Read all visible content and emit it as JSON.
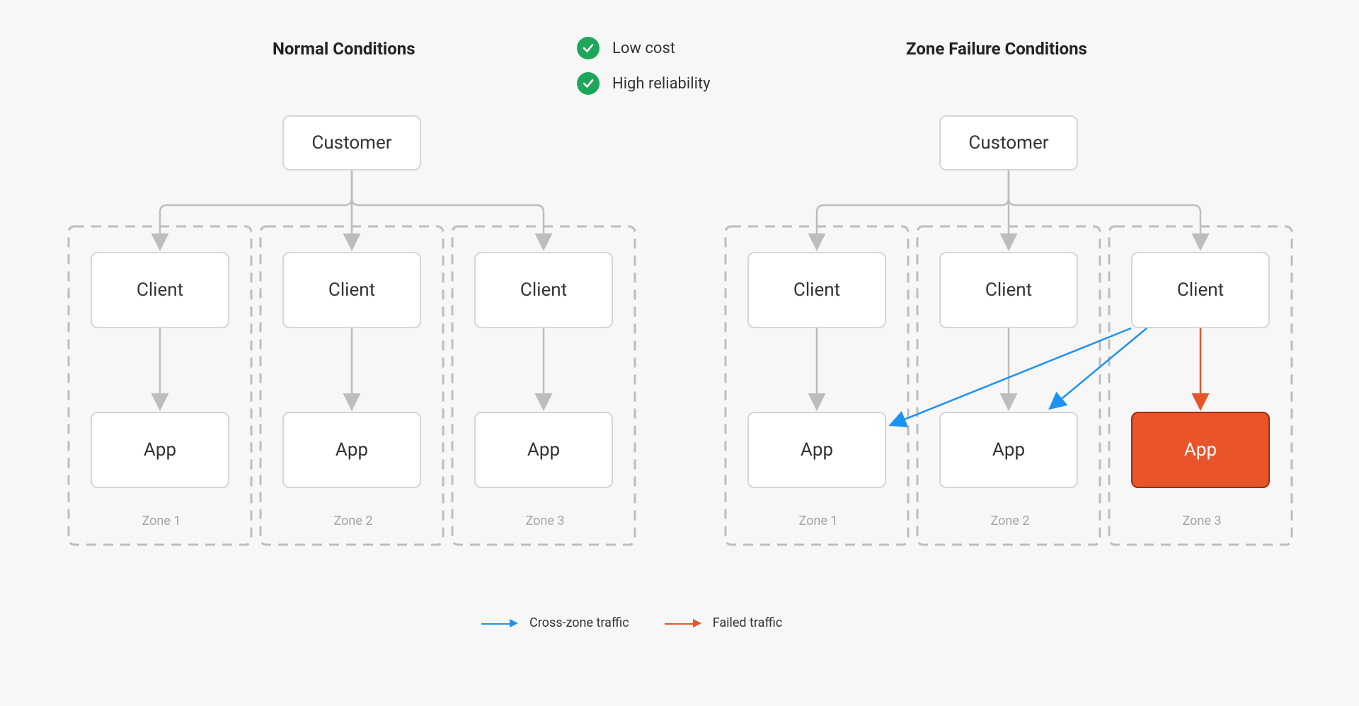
{
  "titles": {
    "left": "Normal Conditions",
    "right": "Zone Failure Conditions"
  },
  "attributes": [
    "Low cost",
    "High reliability"
  ],
  "labels": {
    "customer": "Customer",
    "client": "Client",
    "app": "App"
  },
  "zones": [
    "Zone 1",
    "Zone 2",
    "Zone 3"
  ],
  "legend": {
    "cross_zone": "Cross-zone traffic",
    "failed": "Failed traffic"
  },
  "colors": {
    "cross_zone": "#1C93F3",
    "failed": "#E9542A",
    "neutral": "#BDBDBD",
    "check": "#1EA65A"
  },
  "diagram": {
    "left": {
      "zones": [
        {
          "client_failed": false,
          "app_failed": false
        },
        {
          "client_failed": false,
          "app_failed": false
        },
        {
          "client_failed": false,
          "app_failed": false
        }
      ],
      "cross_zone_arrows": [],
      "failed_arrows": []
    },
    "right": {
      "zones": [
        {
          "client_failed": false,
          "app_failed": false
        },
        {
          "client_failed": false,
          "app_failed": false
        },
        {
          "client_failed": false,
          "app_failed": true
        }
      ],
      "cross_zone_arrows": [
        {
          "from_client_zone": 3,
          "to_app_zone": 1
        },
        {
          "from_client_zone": 3,
          "to_app_zone": 2
        }
      ],
      "failed_arrows": [
        {
          "from_client_zone": 3,
          "to_app_zone": 3
        }
      ]
    }
  }
}
